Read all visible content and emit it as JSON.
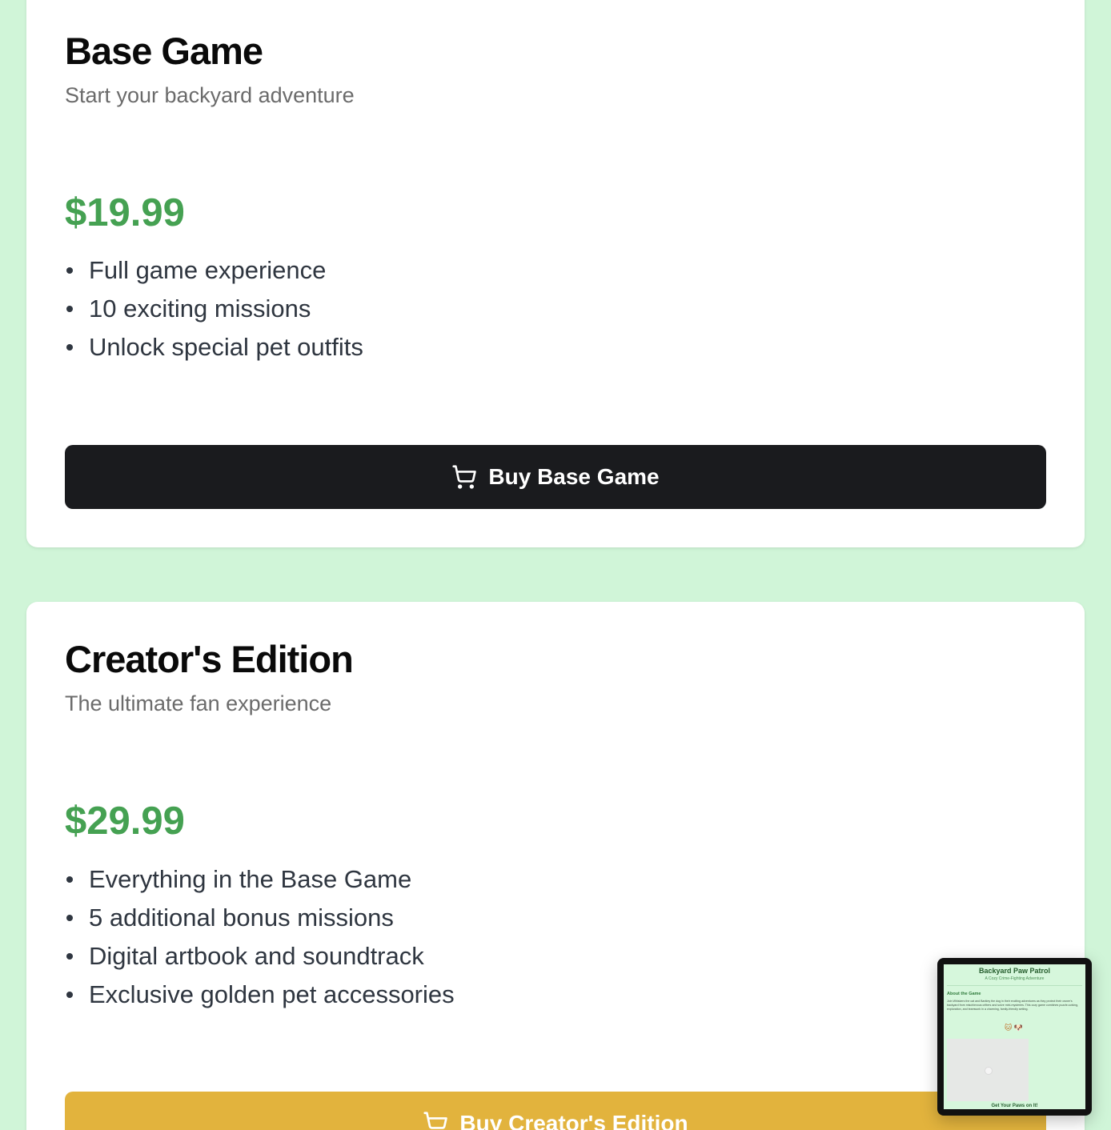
{
  "cards": [
    {
      "title": "Base Game",
      "subtitle": "Start your backyard adventure",
      "price": "$19.99",
      "features": [
        "Full game experience",
        "10 exciting missions",
        "Unlock special pet outfits"
      ],
      "button_label": "Buy Base Game",
      "button_icon": "cart-icon"
    },
    {
      "title": "Creator's Edition",
      "subtitle": "The ultimate fan experience",
      "price": "$29.99",
      "features": [
        "Everything in the Base Game",
        "5 additional bonus missions",
        "Digital artbook and soundtrack",
        "Exclusive golden pet accessories"
      ],
      "button_label": "Buy Creator's Edition",
      "button_icon": "cart-icon"
    }
  ],
  "preview": {
    "title": "Backyard Paw Patrol",
    "tagline": "A Cozy Crime-Fighting Adventure",
    "about_heading": "About the Game",
    "about_text": "Join Whiskers the cat and Barkley the dog in their exciting adventures as they protect their owner's backyard from mischievous critters and solve mini-mysteries. This cozy game combines puzzle-solving, exploration, and teamwork in a charming, family-friendly setting.",
    "pets": "🐱 🐶",
    "cta": "Get Your Paws on It!"
  },
  "colors": {
    "background": "#d0f5d8",
    "price": "#45a152",
    "button_dark": "#1a1b1e",
    "button_gold": "#e2b33d"
  }
}
